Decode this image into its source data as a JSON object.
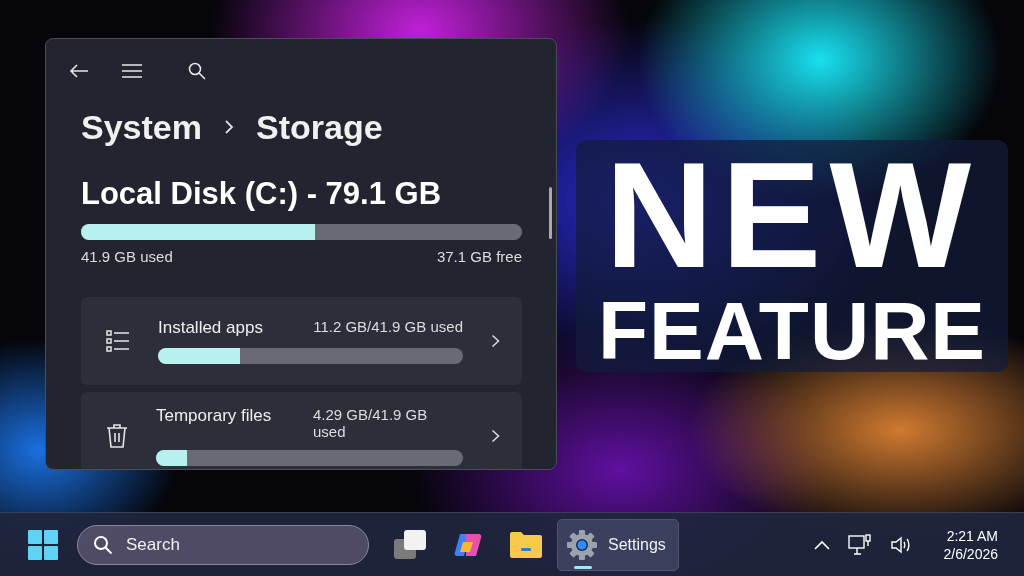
{
  "window": {
    "breadcrumb": [
      {
        "label": "System"
      },
      {
        "label": "Storage"
      }
    ],
    "drive": {
      "title": "Local Disk (C:) - 79.1 GB",
      "level": 0.53,
      "used": "41.9 GB used",
      "free": "37.1 GB free"
    },
    "categories": [
      {
        "kind": "apps",
        "name": "Installed apps",
        "usage": "11.2 GB/41.9 GB used",
        "level": 0.27
      },
      {
        "kind": "temp",
        "name": "Temporary files",
        "usage": "4.29 GB/41.9 GB used",
        "level": 0.1
      }
    ]
  },
  "banner": {
    "lines": [
      "NEW",
      "FEATURE"
    ]
  },
  "taskbar": {
    "search": {
      "placeholder": "Search"
    },
    "apps": [
      {
        "kind": "task-view",
        "selected": false
      },
      {
        "kind": "copilot",
        "selected": false
      },
      {
        "kind": "explorer",
        "selected": false
      },
      {
        "kind": "settings",
        "label": "Settings",
        "selected": true
      }
    ],
    "time": "2:21 AM",
    "date": "2/6/2026"
  }
}
